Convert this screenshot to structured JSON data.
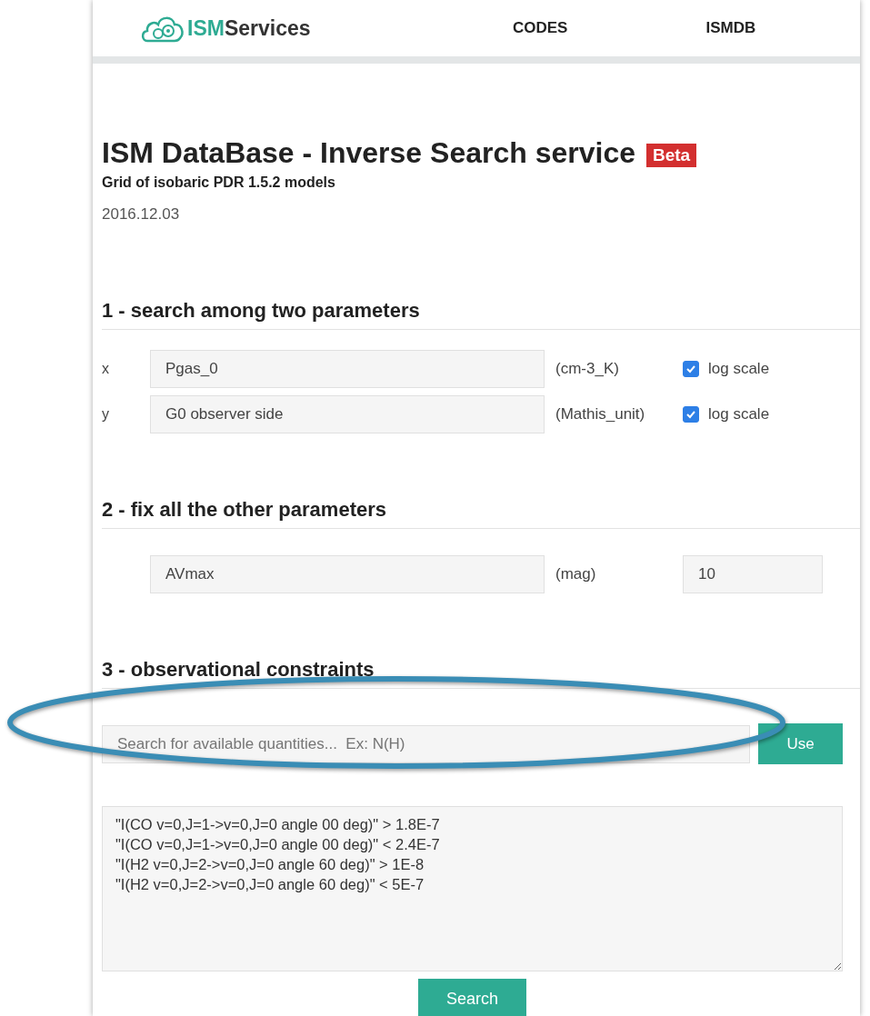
{
  "header": {
    "logo": {
      "accent": "ISM",
      "rest": "Services"
    },
    "nav": [
      "CODES",
      "ISMDB"
    ]
  },
  "title": "ISM DataBase - Inverse Search service",
  "badge": "Beta",
  "subtitle": "Grid of isobaric PDR 1.5.2 models",
  "date": "2016.12.03",
  "sections": [
    {
      "kind": "axes",
      "heading": "1 - search among two parameters",
      "rows": [
        {
          "axis": "x",
          "value": "Pgas_0",
          "unit": "(cm-3_K)",
          "option": {
            "label": "log scale",
            "checked": true
          }
        },
        {
          "axis": "y",
          "value": "G0 observer side",
          "unit": "(Mathis_unit)",
          "option": {
            "label": "log scale",
            "checked": true
          }
        }
      ]
    },
    {
      "kind": "fixed",
      "heading": "2 - fix all the other parameters",
      "rows": [
        {
          "name": "AVmax",
          "unit": "(mag)",
          "value": "10"
        }
      ]
    },
    {
      "kind": "constraints",
      "heading": "3 - observational constraints",
      "search": {
        "placeholder": "Search for available quantities...  Ex: N(H)",
        "button": "Use"
      },
      "lines": [
        "\"I(CO v=0,J=1->v=0,J=0 angle 00 deg)\" > 1.8E-7",
        "\"I(CO v=0,J=1->v=0,J=0 angle 00 deg)\" < 2.4E-7",
        "\"I(H2 v=0,J=2->v=0,J=0 angle 60 deg)\" > 1E-8",
        "\"I(H2 v=0,J=2->v=0,J=0 angle 60 deg)\" < 5E-7"
      ],
      "submit": "Search"
    }
  ],
  "annotation": {
    "kind": "ellipse"
  }
}
